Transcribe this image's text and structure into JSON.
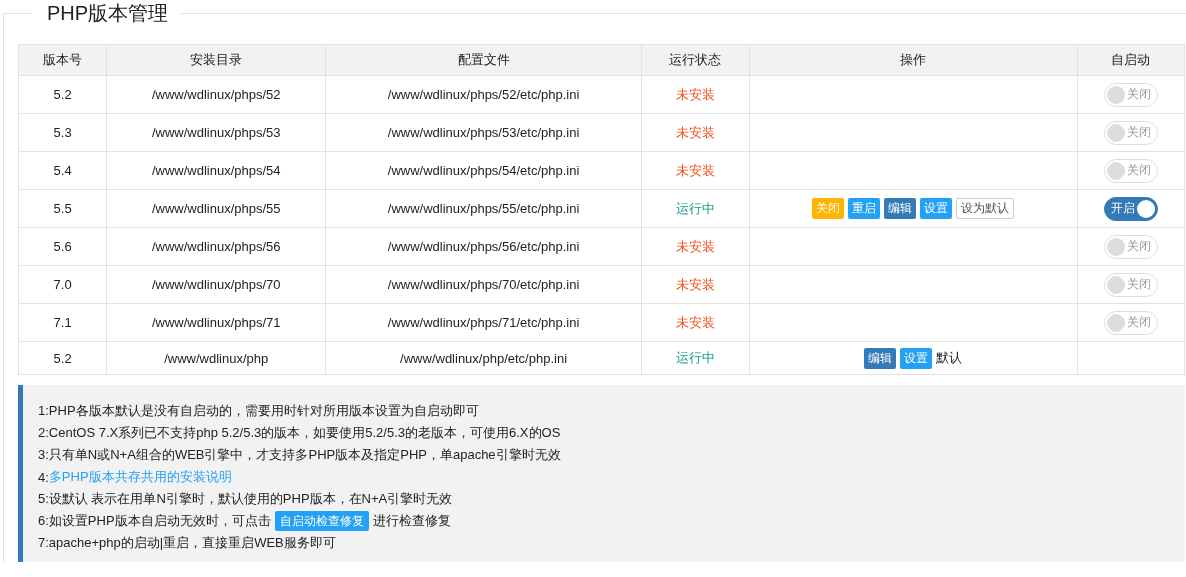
{
  "title": "PHP版本管理",
  "table": {
    "columns": [
      "版本号",
      "安装目录",
      "配置文件",
      "运行状态",
      "操作",
      "自启动"
    ],
    "rows": [
      {
        "version": "5.2",
        "dir": "/www/wdlinux/phps/52",
        "config": "/www/wdlinux/phps/52/etc/php.ini",
        "status": {
          "text": "未安装",
          "kind": "stopped"
        },
        "autostart": {
          "label": "关闭",
          "on": false
        }
      },
      {
        "version": "5.3",
        "dir": "/www/wdlinux/phps/53",
        "config": "/www/wdlinux/phps/53/etc/php.ini",
        "status": {
          "text": "未安装",
          "kind": "stopped"
        },
        "autostart": {
          "label": "关闭",
          "on": false
        }
      },
      {
        "version": "5.4",
        "dir": "/www/wdlinux/phps/54",
        "config": "/www/wdlinux/phps/54/etc/php.ini",
        "status": {
          "text": "未安装",
          "kind": "stopped"
        },
        "autostart": {
          "label": "关闭",
          "on": false
        }
      },
      {
        "version": "5.5",
        "dir": "/www/wdlinux/phps/55",
        "config": "/www/wdlinux/phps/55/etc/php.ini",
        "status": {
          "text": "运行中",
          "kind": "running"
        },
        "actions": [
          {
            "label": "关闭",
            "kind": "warning"
          },
          {
            "label": "重启",
            "kind": "info"
          },
          {
            "label": "编辑",
            "kind": "primary"
          },
          {
            "label": "设置",
            "kind": "info"
          },
          {
            "label": "设为默认",
            "kind": "plain"
          }
        ],
        "autostart": {
          "label": "开启",
          "on": true
        }
      },
      {
        "version": "5.6",
        "dir": "/www/wdlinux/phps/56",
        "config": "/www/wdlinux/phps/56/etc/php.ini",
        "status": {
          "text": "未安装",
          "kind": "stopped"
        },
        "autostart": {
          "label": "关闭",
          "on": false
        }
      },
      {
        "version": "7.0",
        "dir": "/www/wdlinux/phps/70",
        "config": "/www/wdlinux/phps/70/etc/php.ini",
        "status": {
          "text": "未安装",
          "kind": "stopped"
        },
        "autostart": {
          "label": "关闭",
          "on": false
        }
      },
      {
        "version": "7.1",
        "dir": "/www/wdlinux/phps/71",
        "config": "/www/wdlinux/phps/71/etc/php.ini",
        "status": {
          "text": "未安装",
          "kind": "stopped"
        },
        "autostart": {
          "label": "关闭",
          "on": false
        }
      },
      {
        "version": "5.2",
        "dir": "/www/wdlinux/php",
        "config": "/www/wdlinux/php/etc/php.ini",
        "status": {
          "text": "运行中",
          "kind": "running"
        },
        "actions": [
          {
            "label": "编辑",
            "kind": "primary"
          },
          {
            "label": "设置",
            "kind": "info"
          },
          {
            "label": "默认",
            "kind": "text"
          }
        ]
      }
    ]
  },
  "notes": [
    [
      {
        "kind": "text",
        "text": "1:PHP各版本默认是没有自启动的，需要用时针对所用版本设置为自启动即可"
      }
    ],
    [
      {
        "kind": "text",
        "text": "2:CentOS 7.X系列已不支持php 5.2/5.3的版本，如要使用5.2/5.3的老版本，可使用6.X的OS"
      }
    ],
    [
      {
        "kind": "text",
        "text": "3:只有单N或N+A组合的WEB引擎中，才支持多PHP版本及指定PHP，单apache引擎时无效"
      }
    ],
    [
      {
        "kind": "text",
        "text": "4:"
      },
      {
        "kind": "link",
        "text": "多PHP版本共存共用的安装说明"
      }
    ],
    [
      {
        "kind": "text",
        "text": "5:设默认 表示在用单N引擎时，默认使用的PHP版本，在N+A引擎时无效"
      }
    ],
    [
      {
        "kind": "text",
        "text": "6:如设置PHP版本自启动无效时，可点击"
      },
      {
        "kind": "button",
        "text": "自启动检查修复"
      },
      {
        "kind": "text",
        "text": "进行检查修复"
      }
    ],
    [
      {
        "kind": "text",
        "text": "7:apache+php的启动|重启，直接重启WEB服务即可"
      }
    ]
  ]
}
